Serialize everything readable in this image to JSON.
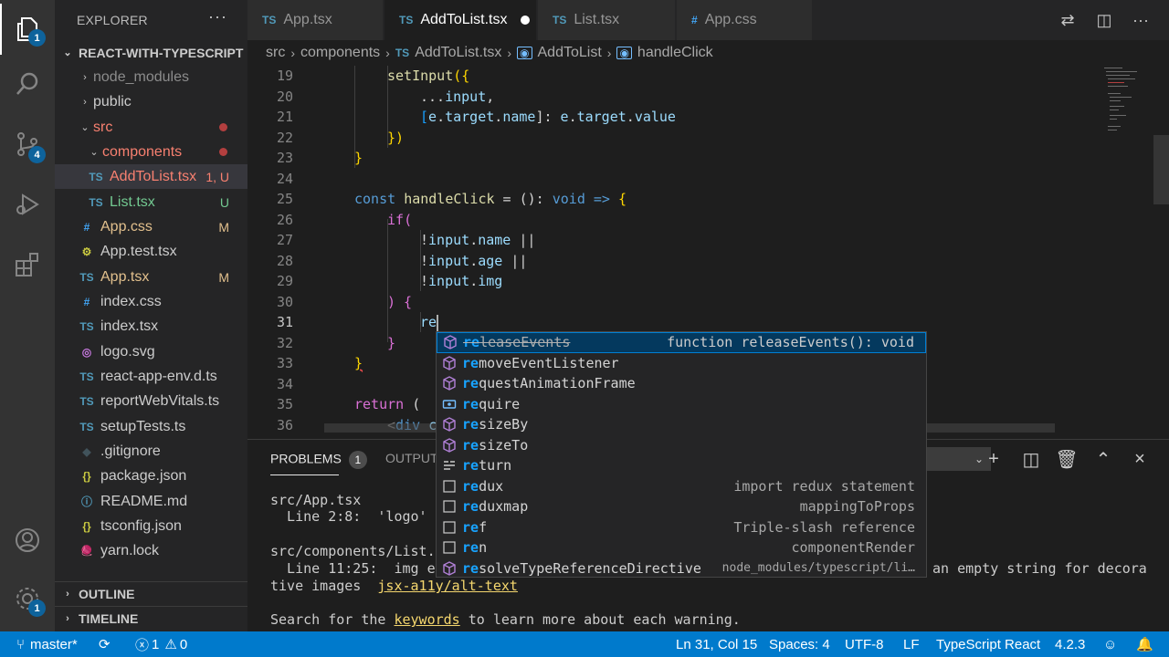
{
  "activity_bar": {
    "explorer_badge": "1",
    "scm_badge": "4",
    "settings_badge": "1"
  },
  "sidebar": {
    "title": "EXPLORER",
    "more_label": "···",
    "project": "REACT-WITH-TYPESCRIPT",
    "items": [
      {
        "label": "node_modules",
        "icon": "›",
        "deco": ""
      },
      {
        "label": "public",
        "icon": "›",
        "deco": ""
      },
      {
        "label": "src",
        "icon": "⌄",
        "deco": ""
      },
      {
        "label": "components",
        "icon": "⌄",
        "deco": ""
      },
      {
        "label": "AddToList.tsx",
        "icon": "TS",
        "deco": "1, U"
      },
      {
        "label": "List.tsx",
        "icon": "TS",
        "deco": "U"
      },
      {
        "label": "App.css",
        "icon": "#",
        "deco": "M"
      },
      {
        "label": "App.test.tsx",
        "icon": "⚙",
        "deco": ""
      },
      {
        "label": "App.tsx",
        "icon": "TS",
        "deco": "M"
      },
      {
        "label": "index.css",
        "icon": "#",
        "deco": ""
      },
      {
        "label": "index.tsx",
        "icon": "TS",
        "deco": ""
      },
      {
        "label": "logo.svg",
        "icon": "◎",
        "deco": ""
      },
      {
        "label": "react-app-env.d.ts",
        "icon": "TS",
        "deco": ""
      },
      {
        "label": "reportWebVitals.ts",
        "icon": "TS",
        "deco": ""
      },
      {
        "label": "setupTests.ts",
        "icon": "TS",
        "deco": ""
      },
      {
        "label": ".gitignore",
        "icon": "◆",
        "deco": ""
      },
      {
        "label": "package.json",
        "icon": "{}",
        "deco": ""
      },
      {
        "label": "README.md",
        "icon": "ⓘ",
        "deco": ""
      },
      {
        "label": "tsconfig.json",
        "icon": "{}",
        "deco": ""
      },
      {
        "label": "yarn.lock",
        "icon": "🧶",
        "deco": ""
      }
    ],
    "outline": "OUTLINE",
    "timeline": "TIMELINE"
  },
  "tabs": [
    {
      "icon": "TS",
      "label": "App.tsx"
    },
    {
      "icon": "TS",
      "label": "AddToList.tsx"
    },
    {
      "icon": "TS",
      "label": "List.tsx"
    },
    {
      "icon": "#",
      "label": "App.css"
    }
  ],
  "breadcrumb": {
    "parts": [
      "src",
      "components"
    ],
    "file_icon": "TS",
    "file": "AddToList.tsx",
    "symbol1": "AddToList",
    "symbol2": "handleClick"
  },
  "editor": {
    "line_numbers": [
      "19",
      "20",
      "21",
      "22",
      "23",
      "24",
      "25",
      "26",
      "27",
      "28",
      "29",
      "30",
      "31",
      "32",
      "33",
      "34",
      "35",
      "36"
    ],
    "lines": {
      "l19": [
        "setInput",
        "({"
      ],
      "l20": [
        "...",
        "input",
        ","
      ],
      "l21": [
        "[",
        "e",
        ".",
        "target",
        ".",
        "name",
        "]: ",
        "e",
        ".",
        "target",
        ".",
        "value"
      ],
      "l22": [
        "})"
      ],
      "l23": [
        "}"
      ],
      "l25": [
        "const",
        " ",
        "handleClick",
        " = (): ",
        "void",
        " ",
        "=>",
        " {"
      ],
      "l26": [
        "if",
        "("
      ],
      "l27": [
        "!",
        "input",
        ".",
        "name",
        " ||"
      ],
      "l28": [
        "!",
        "input",
        ".",
        "age",
        " ||"
      ],
      "l29": [
        "!",
        "input",
        ".",
        "img"
      ],
      "l30": [
        ") {"
      ],
      "l31": [
        "re"
      ],
      "l32": [
        "}"
      ],
      "l33": [
        "}"
      ],
      "l35": [
        "return",
        " ("
      ],
      "l36": [
        "<",
        "div",
        " c"
      ]
    }
  },
  "suggestions": [
    {
      "match": "re",
      "rest": "leaseEvents",
      "kind": "method",
      "detail": "function releaseEvents(): void"
    },
    {
      "match": "re",
      "rest": "moveEventListener",
      "kind": "method",
      "detail": ""
    },
    {
      "match": "re",
      "rest": "questAnimationFrame",
      "kind": "method",
      "detail": ""
    },
    {
      "match": "re",
      "rest": "quire",
      "kind": "variable",
      "detail": ""
    },
    {
      "match": "re",
      "rest": "sizeBy",
      "kind": "method",
      "detail": ""
    },
    {
      "match": "re",
      "rest": "sizeTo",
      "kind": "method",
      "detail": ""
    },
    {
      "match": "re",
      "rest": "turn",
      "kind": "keyword",
      "detail": ""
    },
    {
      "match": "re",
      "rest": "dux",
      "kind": "snippet",
      "detail": "import redux statement"
    },
    {
      "match": "re",
      "rest": "duxmap",
      "kind": "snippet",
      "detail": "mappingToProps"
    },
    {
      "match": "re",
      "rest": "f",
      "kind": "snippet",
      "detail": "Triple-slash reference"
    },
    {
      "match": "re",
      "rest": "n",
      "kind": "snippet",
      "detail": "componentRender"
    },
    {
      "match": "re",
      "rest": "solveTypeReferenceDirective",
      "kind": "method",
      "detail": "node_modules/typescript/li…"
    }
  ],
  "panel": {
    "problems_label": "PROBLEMS",
    "problems_count": "1",
    "output_label": "OUTPUT",
    "output_lines": {
      "o1": "src/App.tsx",
      "o2": "  Line 2:8:  'logo' i",
      "o3": "src/components/List.t",
      "o4a": "  Line 11:25:  img el",
      "o4b": " an empty string for decora",
      "o5a": "tive images  ",
      "o5link": "jsx-a11y/alt-text",
      "o6a": "Search for the ",
      "o6link": "keywords",
      "o6b": " to learn more about each warning."
    }
  },
  "statusbar": {
    "branch": "master*",
    "errors": "1",
    "warnings": "0",
    "position": "Ln 31, Col 15",
    "spaces": "Spaces: 4",
    "encoding": "UTF-8",
    "eol": "LF",
    "language": "TypeScript React",
    "version": "4.2.3"
  },
  "colors": {
    "accent": "#007acc",
    "ts_icon": "#519aba",
    "css_icon": "#42a5f5",
    "modified": "#e2c08d",
    "untracked": "#73c991",
    "error_folder": "#f88070"
  }
}
